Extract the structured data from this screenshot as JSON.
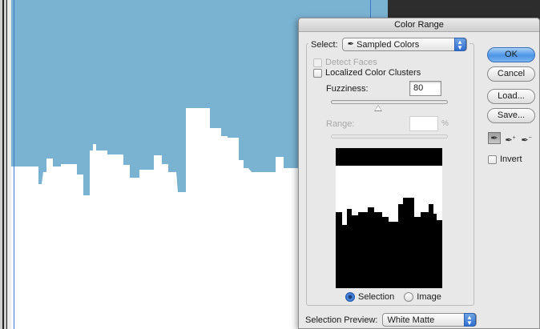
{
  "dialog": {
    "title": "Color Range",
    "select_label": "Select:",
    "select_value": "Sampled Colors",
    "detect_faces_label": "Detect Faces",
    "localized_label": "Localized Color Clusters",
    "fuzziness_label": "Fuzziness:",
    "fuzziness_value": "80",
    "range_label": "Range:",
    "range_value": "",
    "range_unit": "%",
    "radio_selection_label": "Selection",
    "radio_image_label": "Image",
    "radio_selected": "Selection",
    "preview_label": "Selection Preview:",
    "preview_value": "White Matte",
    "ok_label": "OK",
    "cancel_label": "Cancel",
    "load_label": "Load...",
    "save_label": "Save...",
    "invert_label": "Invert",
    "tools": [
      "eyedropper-icon",
      "eyedropper-plus-icon",
      "eyedropper-minus-icon"
    ]
  },
  "colors": {
    "sky": "#7ab3d2",
    "accent": "#3a78d0",
    "preview_black": "#000000",
    "preview_white": "#ffffff"
  }
}
